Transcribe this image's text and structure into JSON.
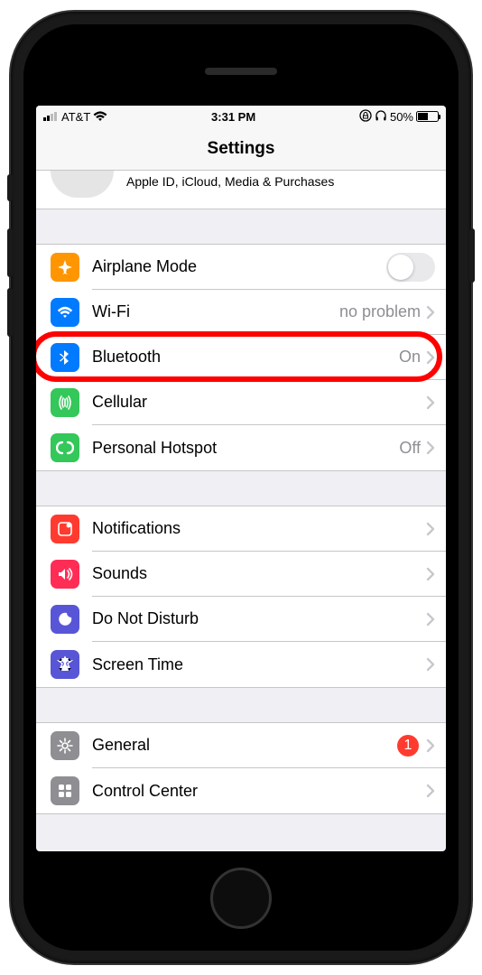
{
  "status": {
    "carrier": "AT&T",
    "time": "3:31 PM",
    "battery_pct": "50%",
    "battery_level": 50
  },
  "header": {
    "title": "Settings"
  },
  "profile": {
    "subtitle": "Apple ID, iCloud, Media & Purchases"
  },
  "groups": [
    {
      "rows": [
        {
          "icon": "airplane",
          "iconColor": "icon-orange",
          "label": "Airplane Mode",
          "type": "toggle",
          "toggle_on": false
        },
        {
          "icon": "wifi",
          "iconColor": "icon-blue",
          "label": "Wi-Fi",
          "type": "link",
          "value": "no problem"
        },
        {
          "icon": "bluetooth",
          "iconColor": "icon-blue",
          "label": "Bluetooth",
          "type": "link",
          "value": "On",
          "highlighted": true
        },
        {
          "icon": "cellular",
          "iconColor": "icon-green",
          "label": "Cellular",
          "type": "link",
          "value": ""
        },
        {
          "icon": "hotspot",
          "iconColor": "icon-green",
          "label": "Personal Hotspot",
          "type": "link",
          "value": "Off"
        }
      ]
    },
    {
      "rows": [
        {
          "icon": "notifications",
          "iconColor": "icon-red",
          "label": "Notifications",
          "type": "link",
          "value": ""
        },
        {
          "icon": "sounds",
          "iconColor": "icon-pink",
          "label": "Sounds",
          "type": "link",
          "value": ""
        },
        {
          "icon": "dnd",
          "iconColor": "icon-indigo",
          "label": "Do Not Disturb",
          "type": "link",
          "value": ""
        },
        {
          "icon": "screentime",
          "iconColor": "icon-indigo",
          "label": "Screen Time",
          "type": "link",
          "value": ""
        }
      ]
    },
    {
      "rows": [
        {
          "icon": "general",
          "iconColor": "icon-gray",
          "label": "General",
          "type": "link",
          "value": "",
          "badge": "1"
        },
        {
          "icon": "controlcenter",
          "iconColor": "icon-gray",
          "label": "Control Center",
          "type": "link",
          "value": ""
        }
      ]
    }
  ]
}
